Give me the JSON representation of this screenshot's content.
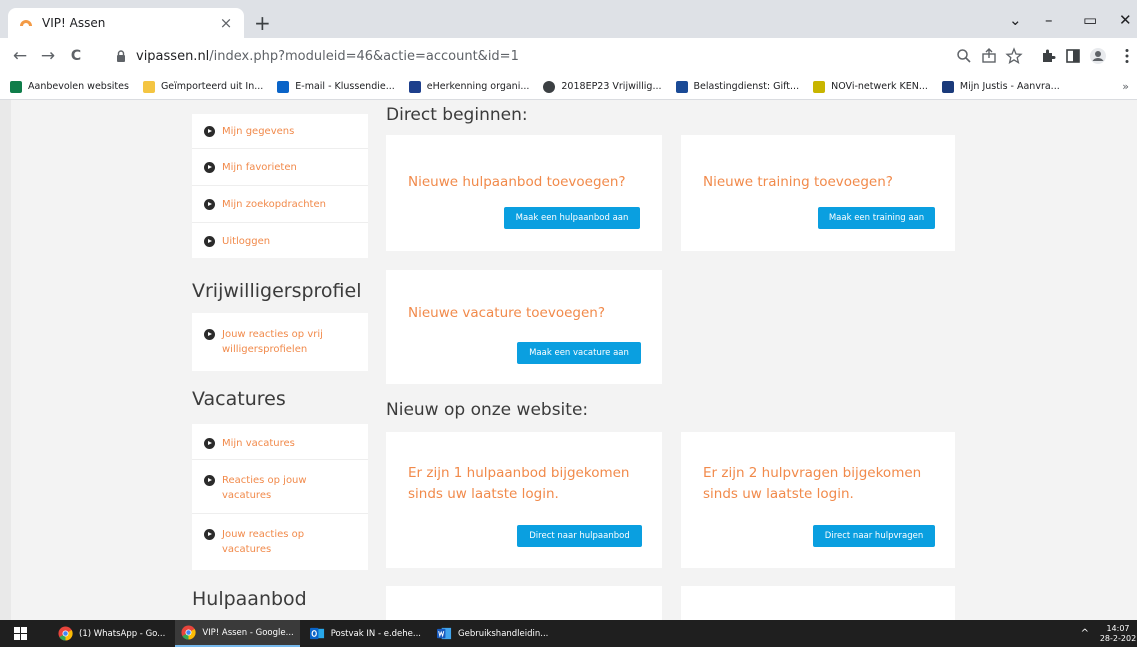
{
  "browser": {
    "tab_title": "VIP! Assen",
    "tab_close": "×",
    "new_tab": "+",
    "win_controls": {
      "chevron": "⌄",
      "minimize": "–",
      "restore": "▭",
      "close": "✕"
    },
    "nav": {
      "back": "←",
      "forward": "→",
      "reload": "C"
    },
    "url_host": "vipassen.nl",
    "url_path": "/index.php?moduleid=46&actie=account&id=1",
    "toolbar_icons": [
      "zoom-icon",
      "share-icon",
      "star-icon",
      "extensions-icon",
      "sidepanel-icon",
      "profile-icon",
      "menu-icon"
    ]
  },
  "bookmarks": {
    "items": [
      {
        "label": "Aanbevolen websites",
        "color": "#0f7d4a"
      },
      {
        "label": "Geïmporteerd uit In...",
        "color": "#f4c542"
      },
      {
        "label": "E-mail - Klussendie...",
        "color": "#0a64c8"
      },
      {
        "label": "eHerkenning organi...",
        "color": "#1d3f8c"
      },
      {
        "label": "2018EP23 Vrijwillig...",
        "color": "#3c4043"
      },
      {
        "label": "Belastingdienst: Gift...",
        "color": "#1a4a96"
      },
      {
        "label": "NOVi-netwerk KEN...",
        "color": "#c8b500"
      },
      {
        "label": "Mijn Justis - Aanvra...",
        "color": "#1a3a7a"
      }
    ],
    "more": "»"
  },
  "sidebar": {
    "account_items": [
      "Mijn gegevens",
      "Mijn favorieten",
      "Mijn zoekopdrachten",
      "Uitloggen"
    ],
    "vrijwilligers_title": "Vrijwilligersprofiel",
    "vrijwilligers_items": [
      "Jouw reacties op vrij willigersprofielen"
    ],
    "vacatures_title": "Vacatures",
    "vacatures_items": [
      "Mijn vacatures",
      "Reacties op jouw vacatures",
      "Jouw reacties op vacatures"
    ],
    "hulpaanbod_title": "Hulpaanbod"
  },
  "main": {
    "direct_heading": "Direct beginnen:",
    "card_hulpaanbod_text": "Nieuwe hulpaanbod toevoegen?",
    "card_hulpaanbod_btn": "Maak een hulpaanbod aan",
    "card_training_text": "Nieuwe training toevoegen?",
    "card_training_btn": "Maak een training aan",
    "card_vacature_text": "Nieuwe vacature toevoegen?",
    "card_vacature_btn": "Maak een vacature aan",
    "nieuw_heading": "Nieuw op onze website:",
    "card_new_hulpaanbod_text": "Er zijn 1 hulpaanbod bijgekomen sinds uw laatste login.",
    "card_new_hulpaanbod_btn": "Direct naar hulpaanbod",
    "card_new_hulpvragen_text": "Er zijn 2 hulpvragen bijgekomen sinds uw laatste login.",
    "card_new_hulpvragen_btn": "Direct naar hulpvragen"
  },
  "taskbar": {
    "items": [
      {
        "label": "(1) WhatsApp - Go...",
        "icon": "chrome-icon"
      },
      {
        "label": "VIP! Assen - Google...",
        "icon": "chrome-icon",
        "active": true
      },
      {
        "label": "Postvak IN - e.dehe...",
        "icon": "outlook-icon"
      },
      {
        "label": "Gebruikshandleidin...",
        "icon": "word-icon"
      }
    ],
    "tray_chevron": "^",
    "time": "14:07",
    "date": "28-2-202"
  },
  "colors": {
    "accent_orange": "#f18a4b",
    "button_blue": "#0a9fe0",
    "page_bg": "#f3f3f3"
  }
}
